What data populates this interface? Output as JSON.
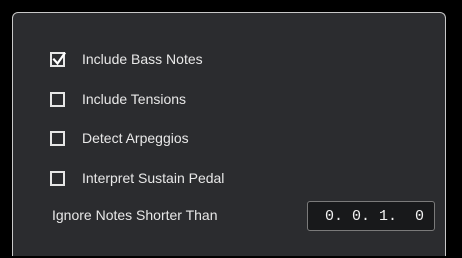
{
  "options": [
    {
      "label": "Include Bass Notes",
      "checked": true
    },
    {
      "label": "Include Tensions",
      "checked": false
    },
    {
      "label": "Detect Arpeggios",
      "checked": false
    },
    {
      "label": "Interpret Sustain Pedal",
      "checked": false
    }
  ],
  "ignore_notes": {
    "label": "Ignore Notes Shorter Than",
    "value": "0. 0. 1.  0"
  },
  "colors": {
    "panel_background": "#2b2c2f",
    "page_background": "#000000",
    "text": "#e8e8e8",
    "field_background": "#18191b"
  },
  "icons": {
    "checked_mark": "check-icon"
  }
}
